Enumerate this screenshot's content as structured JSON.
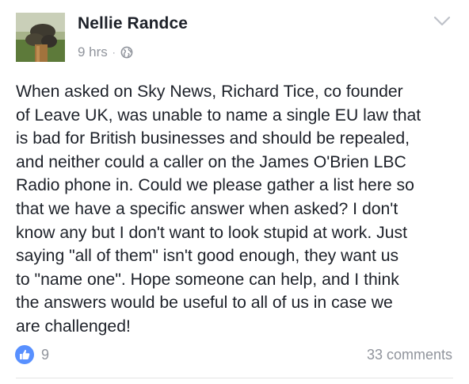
{
  "post": {
    "author": "Nellie Randce",
    "timestamp": "9 hrs",
    "separator": "·",
    "privacy_icon": "globe-icon",
    "menu_icon": "chevron-down-icon",
    "text": "When asked on Sky News, Richard Tice, co founder\nof Leave UK, was unable to name a single EU law that\nis bad for British businesses and should be repealed,\nand neither could a caller on the James O'Brien LBC\nRadio phone in. Could we please gather a list here so\nthat we have a specific answer when asked? I don't\nknow any but I don't want to look stupid at work. Just\nsaying \"all of them\" isn't good enough, they want us\nto \"name one\". Hope someone can help, and I think\nthe answers would be useful to all of us in case we\nare challenged!"
  },
  "footer": {
    "like_icon": "thumbs-up-icon",
    "like_count": "9",
    "comments_label": "33 comments"
  },
  "colors": {
    "like_blue": "#5890ff",
    "meta_gray": "#90949c",
    "text": "#1d2129"
  }
}
